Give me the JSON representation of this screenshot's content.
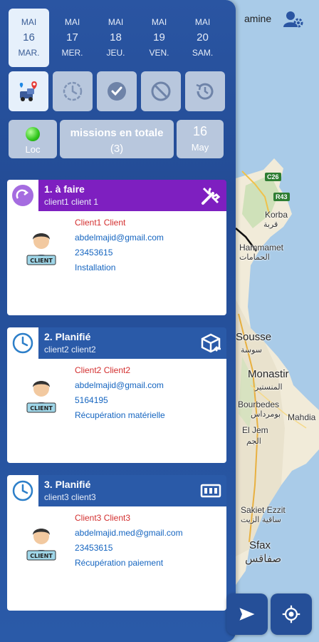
{
  "user": {
    "name": "amine"
  },
  "map": {
    "places": [
      "C26",
      "R43",
      "Korba",
      "Hammamet",
      "Sousse",
      "Monastir",
      "Bourbedes",
      "El Jem",
      "Mahdia",
      "Sakiet Ezzit",
      "Sfax"
    ],
    "places_ar": [
      "قربة",
      "الحمامات",
      "سوسة",
      "المنستير",
      "بومرداس",
      "الجم",
      "ساقية الزيت",
      "صفاقس"
    ]
  },
  "days": [
    {
      "month": "MAI",
      "num": "16",
      "dow": "MAR.",
      "active": true
    },
    {
      "month": "MAI",
      "num": "17",
      "dow": "MER.",
      "active": false
    },
    {
      "month": "MAI",
      "num": "18",
      "dow": "JEU.",
      "active": false
    },
    {
      "month": "MAI",
      "num": "19",
      "dow": "VEN.",
      "active": false
    },
    {
      "month": "MAI",
      "num": "20",
      "dow": "SAM.",
      "active": false
    }
  ],
  "stats": {
    "loc_label": "Loc",
    "total_label": "missions en totale",
    "total_count": "(3)",
    "date_day": "16",
    "date_month": "May"
  },
  "missions": [
    {
      "title": "1. à faire",
      "subtitle": "client1  client 1",
      "color": "#7e1fc0",
      "client_name": "Client1 Client",
      "email": "abdelmajid@gmail.com",
      "phone": "23453615",
      "type": "Installation"
    },
    {
      "title": "2. Planifié",
      "subtitle": "client2 client2",
      "color": "#2a5aa8",
      "client_name": "Client2 Client2",
      "email": "abdelmajid@gmail.com",
      "phone": "5164195",
      "type": "Récupération matérielle"
    },
    {
      "title": "3. Planifié",
      "subtitle": "client3 client3",
      "color": "#2a5aa8",
      "client_name": "Client3 Client3",
      "email": "abdelmajid.med@gmail.com",
      "phone": "23453615",
      "type": "Récupération paiement"
    }
  ],
  "avatar_badge": "CLIENT",
  "colors": {
    "panel": "#234c96",
    "accent_purple": "#7e1fc0",
    "client_red": "#d32f2f",
    "link_blue": "#1565c0"
  }
}
